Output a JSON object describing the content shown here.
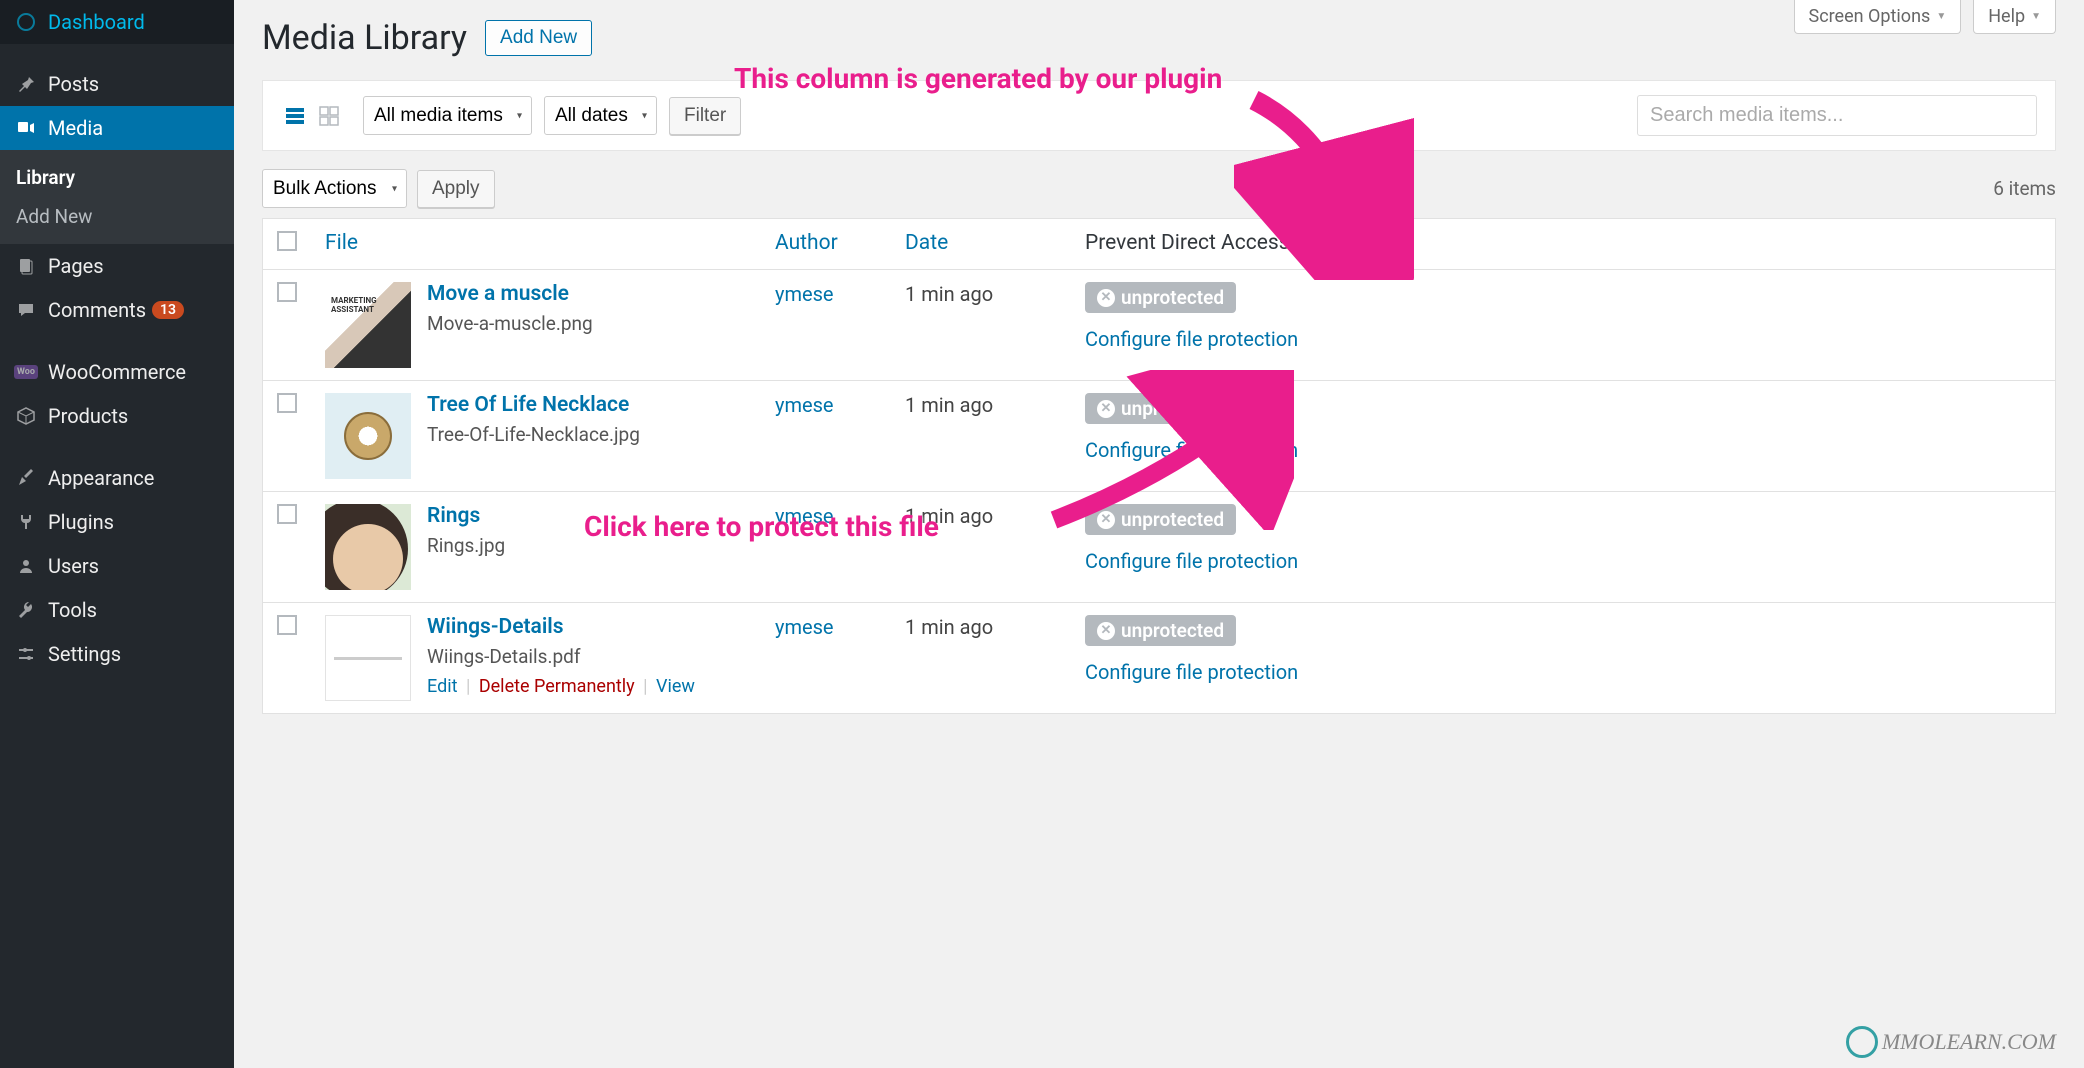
{
  "sidebar": {
    "items": [
      {
        "label": "Dashboard"
      },
      {
        "label": "Posts"
      },
      {
        "label": "Media"
      },
      {
        "label": "Pages"
      },
      {
        "label": "Comments",
        "badge": "13"
      },
      {
        "label": "WooCommerce"
      },
      {
        "label": "Products"
      },
      {
        "label": "Appearance"
      },
      {
        "label": "Plugins"
      },
      {
        "label": "Users"
      },
      {
        "label": "Tools"
      },
      {
        "label": "Settings"
      }
    ],
    "submenu": [
      {
        "label": "Library"
      },
      {
        "label": "Add New"
      }
    ]
  },
  "topTabs": {
    "screenOptions": "Screen Options",
    "help": "Help"
  },
  "page": {
    "title": "Media Library",
    "addNew": "Add New"
  },
  "filters": {
    "mediaType": "All media items",
    "dates": "All dates",
    "filterBtn": "Filter",
    "searchPlaceholder": "Search media items..."
  },
  "bulk": {
    "label": "Bulk Actions",
    "apply": "Apply",
    "itemsCount": "6 items"
  },
  "table": {
    "headers": {
      "file": "File",
      "author": "Author",
      "date": "Date",
      "pda": "Prevent Direct Access"
    },
    "rows": [
      {
        "title": "Move a muscle",
        "filename": "Move-a-muscle.png",
        "author": "ymese",
        "date": "1 min ago",
        "status": "unprotected",
        "configure": "Configure file protection"
      },
      {
        "title": "Tree Of Life Necklace",
        "filename": "Tree-Of-Life-Necklace.jpg",
        "author": "ymese",
        "date": "1 min ago",
        "status": "unprotected",
        "configure": "Configure file protection"
      },
      {
        "title": "Rings",
        "filename": "Rings.jpg",
        "author": "ymese",
        "date": "1 min ago",
        "status": "unprotected",
        "configure": "Configure file protection"
      },
      {
        "title": "Wiings-Details",
        "filename": "Wiings-Details.pdf",
        "author": "ymese",
        "date": "1 min ago",
        "status": "unprotected",
        "configure": "Configure file protection"
      }
    ],
    "rowActions": {
      "edit": "Edit",
      "delete": "Delete Permanently",
      "view": "View"
    }
  },
  "annotations": {
    "col": "This column is generated by our plugin",
    "click": "Click here to protect this file"
  },
  "watermark": "MMOLEARN.COM"
}
